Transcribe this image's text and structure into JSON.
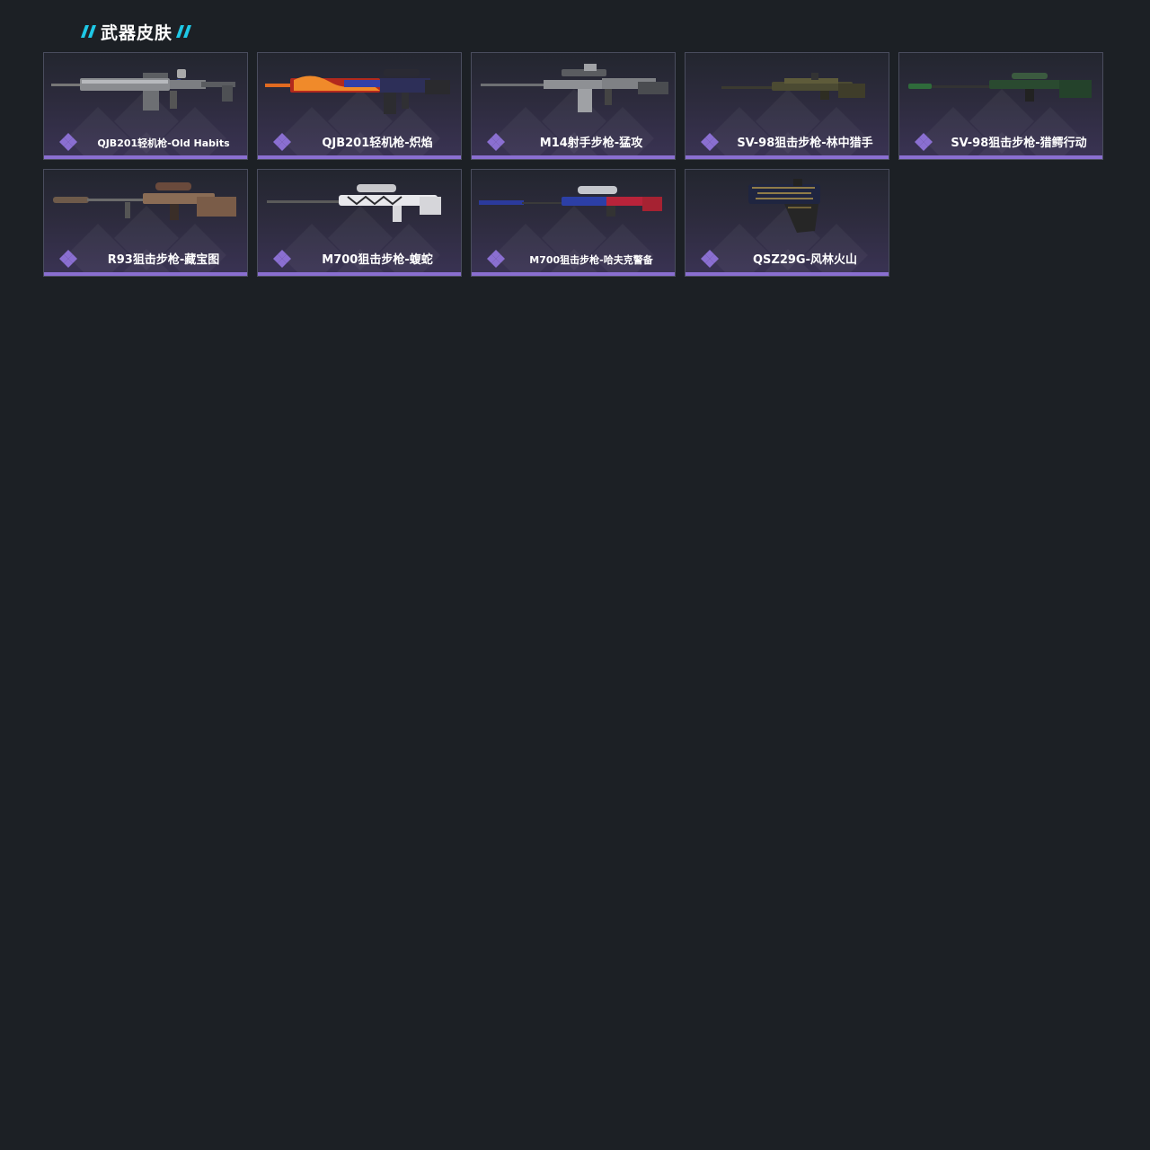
{
  "section": {
    "title": "武器皮肤",
    "accent_color": "#1ec8e6"
  },
  "colors": {
    "rarity_purple": "#8a6fd1",
    "card_border": "#4a4d5e"
  },
  "skins": [
    {
      "name": "QJB201轻机枪-Old Habits",
      "rarity_icon": "diamond-cluster-icon",
      "weapon_art": "lmg-gray",
      "small": true
    },
    {
      "name": "QJB201轻机枪-炽焰",
      "rarity_icon": "diamond-cluster-icon",
      "weapon_art": "lmg-flame",
      "small": false
    },
    {
      "name": "M14射手步枪-猛攻",
      "rarity_icon": "diamond-cluster-icon",
      "weapon_art": "dmr-gray",
      "small": false
    },
    {
      "name": "SV-98狙击步枪-林中猎手",
      "rarity_icon": "diamond-cluster-icon",
      "weapon_art": "sniper-camo",
      "small": false
    },
    {
      "name": "SV-98狙击步枪-猎鳄行动",
      "rarity_icon": "diamond-cluster-icon",
      "weapon_art": "sniper-green",
      "small": false
    },
    {
      "name": "R93狙击步枪-藏宝图",
      "rarity_icon": "diamond-cluster-icon",
      "weapon_art": "sniper-map",
      "small": false
    },
    {
      "name": "M700狙击步枪-蝮蛇",
      "rarity_icon": "diamond-cluster-icon",
      "weapon_art": "sniper-viper",
      "small": false
    },
    {
      "name": "M700狙击步枪-哈夫克警备",
      "rarity_icon": "diamond-cluster-icon",
      "weapon_art": "sniper-blue-red",
      "small": true
    },
    {
      "name": "QSZ29G-风林火山",
      "rarity_icon": "diamond-cluster-icon",
      "weapon_art": "pistol-gold",
      "small": false
    }
  ]
}
